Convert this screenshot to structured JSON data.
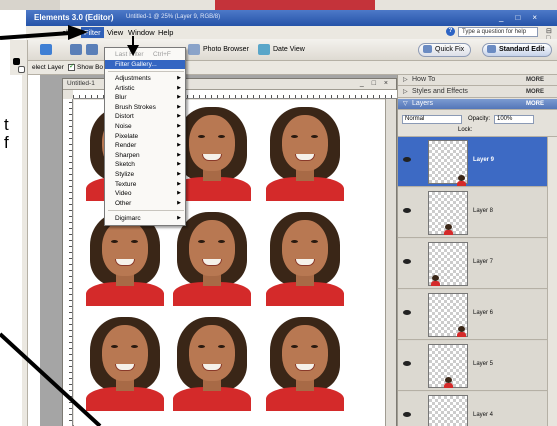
{
  "page_text": {
    "line1": "t",
    "line2": "f"
  },
  "title": {
    "app": "Elements 3.0 (Editor)",
    "doc": "Untitled-1 @ 25% (Layer 9, RGB/8)"
  },
  "menu": {
    "items": [
      "elect",
      "Filter",
      "View",
      "Window",
      "Help"
    ],
    "help_placeholder": "Type a question for help"
  },
  "shortcuts": {
    "photo_browser": "Photo Browser",
    "date_view": "Date View",
    "quick_fix": "Quick Fix",
    "standard_edit": "Standard Edit"
  },
  "options": {
    "select_layer": "elect Layer",
    "show_bounds": "Show Bo"
  },
  "doc_window": {
    "tab": "Untitled-1"
  },
  "filter_menu": {
    "last_filter": "Last Filter",
    "last_filter_shortcut": "Ctrl+F",
    "filter_gallery": "Filter Gallery...",
    "items": [
      "Adjustments",
      "Artistic",
      "Blur",
      "Brush Strokes",
      "Distort",
      "Noise",
      "Pixelate",
      "Render",
      "Sharpen",
      "Sketch",
      "Stylize",
      "Texture",
      "Video",
      "Other"
    ],
    "digimarc": "Digimarc"
  },
  "palette": {
    "how_to": "How To",
    "styles": "Styles and Effects",
    "layers": "Layers",
    "more": "MORE",
    "blend": "Normal",
    "opacity_label": "Opacity:",
    "opacity": "100%",
    "lock_label": "Lock:",
    "layers_list": [
      "Layer 9",
      "Layer 8",
      "Layer 7",
      "Layer 6",
      "Layer 5",
      "Layer 4"
    ]
  },
  "colors": {
    "title_bar": "#2553a8",
    "menu_highlight": "#3466c2",
    "shirt": "#d42a2a",
    "layer_selected": "#3d6ac4"
  }
}
